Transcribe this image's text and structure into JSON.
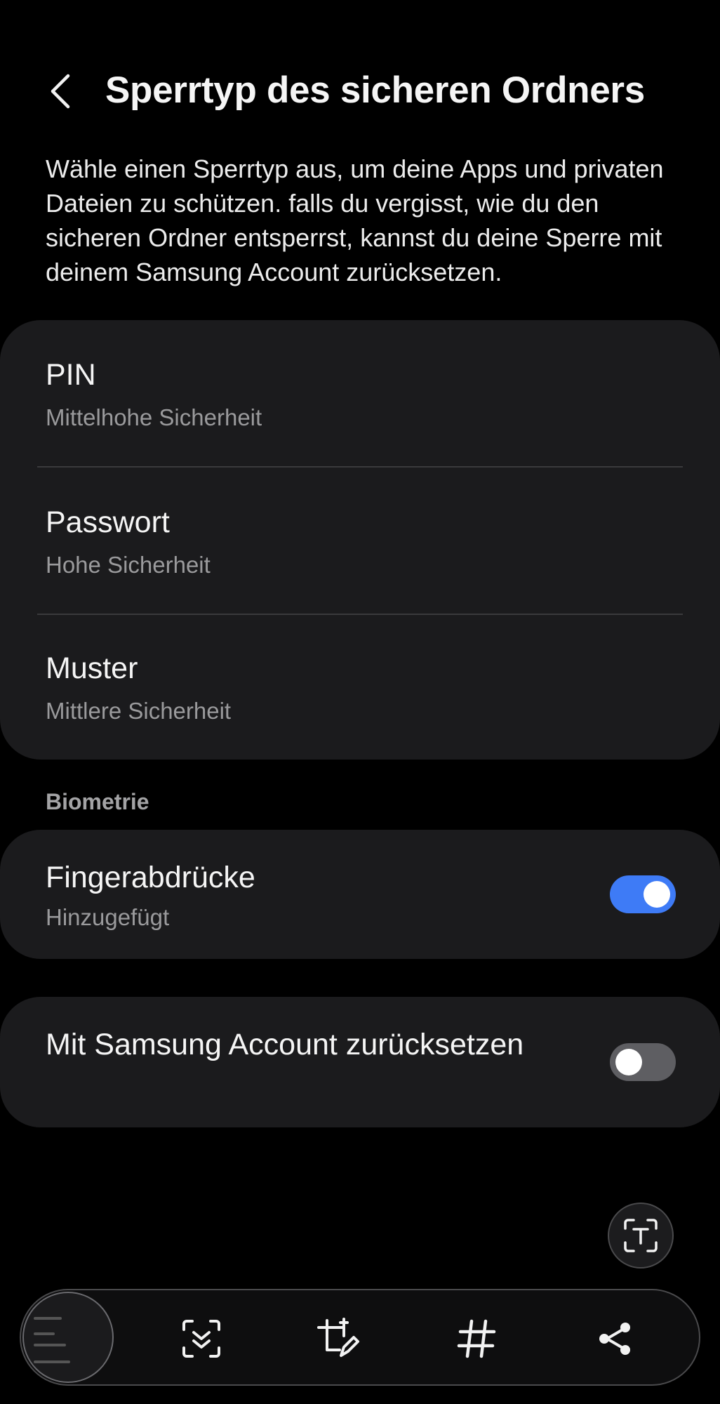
{
  "header": {
    "back_icon": "chevron-left-icon",
    "title": "Sperrtyp des sicheren Ordners"
  },
  "description": "Wähle einen Sperrtyp aus, um deine Apps und privaten Dateien zu schützen. falls du vergisst, wie du den sicheren Ordner entsperrst, kannst du deine Sperre mit deinem Samsung Account zurücksetzen.",
  "lock_types": [
    {
      "title": "PIN",
      "subtitle": "Mittelhohe Sicherheit"
    },
    {
      "title": "Passwort",
      "subtitle": "Hohe Sicherheit"
    },
    {
      "title": "Muster",
      "subtitle": "Mittlere Sicherheit"
    }
  ],
  "biometrics": {
    "section_label": "Biometrie",
    "fingerprints": {
      "title": "Fingerabdrücke",
      "subtitle": "Hinzugefügt",
      "enabled": true
    }
  },
  "reset_with_account": {
    "title": "Mit Samsung Account zurücksetzen",
    "enabled": false
  },
  "colors": {
    "background": "#000000",
    "card": "#1b1b1d",
    "toggle_on": "#3e7bf6",
    "toggle_off": "#5e5e62",
    "subtitle": "#9a9a9c"
  },
  "screenshot_toolbar": {
    "icons": [
      "screenshot-thumbnail",
      "scroll-capture-icon",
      "crop-edit-icon",
      "hashtag-icon",
      "share-icon"
    ],
    "floating_icon": "text-extract-icon"
  }
}
